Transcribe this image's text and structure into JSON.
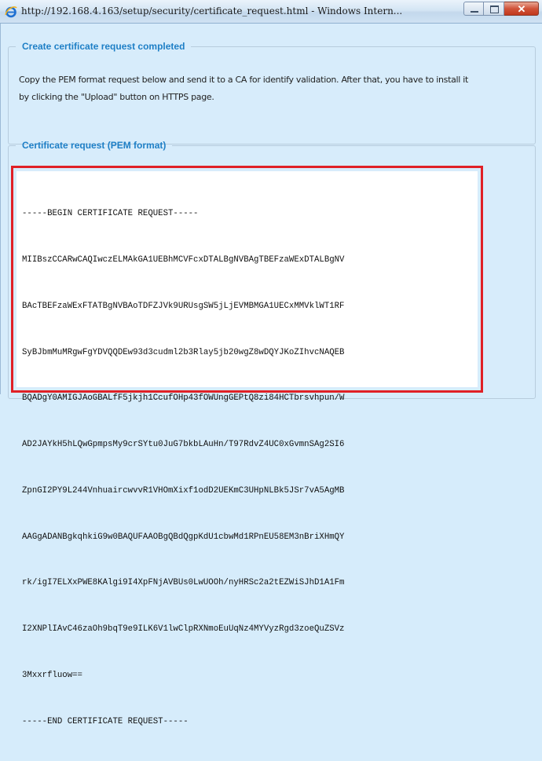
{
  "window": {
    "title": "http://192.168.4.163/setup/security/certificate_request.html - Windows Intern..."
  },
  "section1": {
    "legend": "Create certificate request completed",
    "description_line1": "Copy the PEM format request below and send it to a CA for identify validation. After that, you have to install it",
    "description_line2": "by clicking the \"Upload\" button on HTTPS page."
  },
  "section2": {
    "legend": "Certificate request (PEM format)",
    "pem_lines": [
      "-----BEGIN CERTIFICATE REQUEST-----",
      "MIIBszCCARwCAQIwczELMAkGA1UEBhMCVFcxDTALBgNVBAgTBEFzaWExDTALBgNV",
      "BAcTBEFzaWExFTATBgNVBAoTDFZJVk9URUsgSW5jLjEVMBMGA1UECxMMVklWT1RF",
      "SyBJbmMuMRgwFgYDVQQDEw93d3cudml2b3Rlay5jb20wgZ8wDQYJKoZIhvcNAQEB",
      "BQADgY0AMIGJAoGBALfF5jkjh1CcufOHp43fOWUngGEPtQ8zi84HCTbrsvhpun/W",
      "AD2JAYkH5hLQwGpmpsMy9crSYtu0JuG7bkbLAuHn/T97RdvZ4UC0xGvmnSAg2SI6",
      "ZpnGI2PY9L244VnhuaircwvvR1VHOmXixf1odD2UEKmC3UHpNLBk5JSr7vA5AgMB",
      "AAGgADANBgkqhkiG9w0BAQUFAAOBgQBdQgpKdU1cbwMd1RPnEU58EM3nBriXHmQY",
      "rk/igI7ELXxPWE8KAlgi9I4XpFNjAVBUs0LwUOOh/nyHRSc2a2tEZWiSJhD1A1Fm",
      "I2XNPlIAvC46zaOh9bqT9e9ILK6V1lwClpRXNmoEuUqNz4MYVyzRgd3zoeQuZSVz",
      "3Mxxrfluow==",
      "-----END CERTIFICATE REQUEST-----"
    ]
  },
  "colors": {
    "legend_text": "#1e7fc6",
    "highlight_border": "#e02026",
    "background": "#d7ecfb"
  },
  "icons": {
    "app_icon": "internet-explorer-icon",
    "minimize": "minimize-icon",
    "maximize": "maximize-icon",
    "close": "close-icon"
  }
}
